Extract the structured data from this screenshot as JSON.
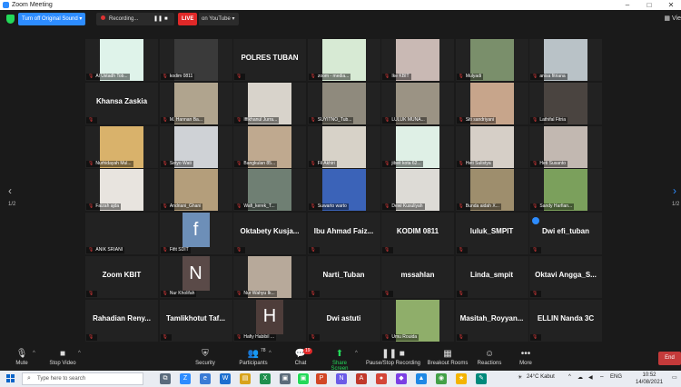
{
  "window": {
    "title": "Zoom Meeting",
    "controls": [
      "–",
      "□",
      "✕"
    ]
  },
  "topbar": {
    "turn_off_label": "Turn off Original Sound",
    "recording_label": "Recording...",
    "pause_glyph": "❚❚",
    "stop_glyph": "■",
    "live_label": "LIVE",
    "youtube_label": "on YouTube",
    "view_label": "Vie"
  },
  "pager": {
    "prev": "‹",
    "next": "›",
    "page": "1/2",
    "page_right": "1/2"
  },
  "tiles": [
    {
      "label": "Al Ustadh Tob...",
      "kind": "video",
      "bg": "#dff3ea"
    },
    {
      "label": "kodim 0811",
      "kind": "video",
      "bg": "#3a3a3a"
    },
    {
      "name": "POLRES TUBAN",
      "kind": "name"
    },
    {
      "label": "zoom - media...",
      "kind": "video",
      "bg": "#d7ead4"
    },
    {
      "label": "Ike KBIT",
      "kind": "video",
      "bg": "#c9b9b4"
    },
    {
      "label": "Mulyadi",
      "kind": "video",
      "bg": "#7a8f6b"
    },
    {
      "label": "anisa fitriana",
      "kind": "video",
      "bg": "#b9c2c7"
    },
    {
      "name": "Khansa Zaskia",
      "kind": "name"
    },
    {
      "label": "M. Hannan Ba...",
      "kind": "video",
      "bg": "#b0a48e"
    },
    {
      "label": "Iffikhanul Jurra...",
      "kind": "video",
      "bg": "#d8d3cb"
    },
    {
      "label": "SUYITNO_Tub...",
      "kind": "video",
      "bg": "#8f8a7d"
    },
    {
      "label": "LULUK MUNA...",
      "kind": "video",
      "bg": "#9b9384"
    },
    {
      "label": "Siti sandriyani",
      "kind": "video",
      "bg": "#c7a58b"
    },
    {
      "label": "Lathifal Fitria",
      "kind": "video",
      "bg": "#4a4440"
    },
    {
      "label": "Nurhidayah Mul...",
      "kind": "video",
      "bg": "#d9b26b"
    },
    {
      "label": "Setyo Wati",
      "kind": "video",
      "bg": "#cfd2d6"
    },
    {
      "label": "Bangkulan 85...",
      "kind": "video",
      "bg": "#bfa98f"
    },
    {
      "label": "Fil Akhiri",
      "kind": "video",
      "bg": "#d7d2c8"
    },
    {
      "label": "jibeit kota 62...",
      "kind": "video",
      "bg": "#dff0e6"
    },
    {
      "label": "Heti Sulistya",
      "kind": "video",
      "bg": "#d6cfc7"
    },
    {
      "label": "Heti Susanto",
      "kind": "video",
      "bg": "#c2b8b1"
    },
    {
      "label": "Faizah ajda",
      "kind": "video",
      "bg": "#e8e4df"
    },
    {
      "label": "Andriani_Ghani",
      "kind": "video",
      "bg": "#b49e7b"
    },
    {
      "label": "Wafi_kerek_T...",
      "kind": "video",
      "bg": "#6f7f73"
    },
    {
      "label": "Suwarto warto",
      "kind": "video",
      "bg": "#3b63b8"
    },
    {
      "label": "Dewi Kusuliyah",
      "kind": "video",
      "bg": "#dddbd6"
    },
    {
      "label": "Bunda aidah X...",
      "kind": "video",
      "bg": "#9e8e6d"
    },
    {
      "label": "Sandy Harfian...",
      "kind": "video",
      "bg": "#7ba05c"
    },
    {
      "label": "ANIK SRIANI",
      "kind": "blank"
    },
    {
      "label": "Fifit SDIT",
      "kind": "avatar",
      "letter": "f",
      "bg": "#6d8fb8"
    },
    {
      "name": "Oktabety Kusja...",
      "kind": "name"
    },
    {
      "name": "Ibu Ahmad Faiz...",
      "kind": "name"
    },
    {
      "name": "KODIM 0811",
      "kind": "name"
    },
    {
      "name": "luluk_SMPIT",
      "kind": "name"
    },
    {
      "name": "Dwi efi_tuban",
      "kind": "name",
      "badge": true
    },
    {
      "name": "Zoom KBIT",
      "kind": "name"
    },
    {
      "label": "Nur Kholifah",
      "kind": "avatar",
      "letter": "N",
      "bg": "#5a4a48"
    },
    {
      "label": "Nur Wahyu Ik...",
      "kind": "video",
      "bg": "#b7a99a"
    },
    {
      "name": "Narti_Tuban",
      "kind": "name"
    },
    {
      "name": "mssahlan",
      "kind": "name"
    },
    {
      "name": "Linda_smpit",
      "kind": "name"
    },
    {
      "name": "Oktavi Angga_S...",
      "kind": "name"
    },
    {
      "name": "Rahadian Reny...",
      "kind": "name"
    },
    {
      "name": "Tamlikhotut Taf...",
      "kind": "name"
    },
    {
      "label": "Hafiy Habibil ...",
      "kind": "avatar",
      "letter": "H",
      "bg": "#4e3d3a"
    },
    {
      "name": "Dwi astuti",
      "kind": "name"
    },
    {
      "label": "Umu Rouida",
      "kind": "video",
      "bg": "#8fae6a"
    },
    {
      "name": "Masitah_Royyan...",
      "kind": "name"
    },
    {
      "name": "ELLIN Nanda 3C",
      "kind": "name"
    }
  ],
  "toolbar": {
    "mute": "Mute",
    "stop_video": "Stop Video",
    "security": "Security",
    "participants": "Participants",
    "participants_count": "78",
    "chat": "Chat",
    "chat_badge": "19",
    "share_screen": "Share Screen",
    "pause_recording": "Pause/Stop Recording",
    "breakout": "Breakout Rooms",
    "reactions": "Reactions",
    "more": "More",
    "end": "End"
  },
  "taskbar": {
    "search_placeholder": "Type here to search",
    "weather": "24°C Kabut",
    "language": "ENG",
    "time": "10:52",
    "date": "14/08/2021"
  },
  "colors": {
    "accent": "#2d8cff",
    "live": "#e02828",
    "end": "#c43a3a",
    "share": "#23d959"
  }
}
